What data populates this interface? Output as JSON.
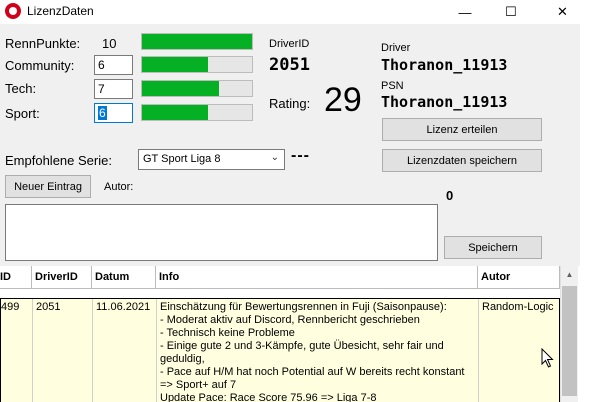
{
  "window": {
    "title": "LizenzDaten",
    "minimize": "—",
    "maximize": "☐",
    "close": "✕"
  },
  "points": {
    "rennpunkte_label": "RennPunkte:",
    "rennpunkte_value": "10",
    "rennpunkte_fraction": 1.0,
    "community_label": "Community:",
    "community_value": "6",
    "community_fraction": 0.6,
    "tech_label": "Tech:",
    "tech_value": "7",
    "tech_fraction": 0.7,
    "sport_label": "Sport:",
    "sport_value": "6",
    "sport_fraction": 0.6
  },
  "driver": {
    "driverid_caption": "DriverID",
    "driverid": "2051",
    "rating_caption": "Rating:",
    "rating": "29",
    "driver_caption": "Driver",
    "driver_name": "Thoranon_11913",
    "psn_caption": "PSN",
    "psn_name": "Thoranon_11913"
  },
  "buttons": {
    "lizenz_erteilen": "Lizenz erteilen",
    "lizenzdaten_speichern": "Lizenzdaten speichern",
    "neuer_eintrag": "Neuer Eintrag",
    "speichern": "Speichern"
  },
  "serie": {
    "label": "Empfohlene Serie:",
    "selected": "GT Sport Liga 8",
    "suffix": "---"
  },
  "entry": {
    "autor_label": "Autor:",
    "count": "0"
  },
  "table": {
    "headers": [
      "ID",
      "DriverID",
      "Datum",
      "Info",
      "Autor"
    ],
    "row": {
      "id": "499",
      "driverid": "2051",
      "datum": "11.06.2021",
      "info": [
        "Einschätzung für Bewertungsrennen in Fuji (Saisonpause):",
        "- Moderat aktiv auf Discord, Rennbericht geschrieben",
        "- Technisch keine Probleme",
        "- Einige gute 2 und 3-Kämpfe, gute Übesicht, sehr fair und",
        "geduldig,",
        "- Pace auf H/M hat noch Potential auf W bereits recht konstant",
        "=> Sport+ auf 7",
        "Update Pace: Race Score 75.96 => Liga 7-8"
      ],
      "autor": "Random-Logic"
    }
  },
  "colors": {
    "progress_fill": "#06b025",
    "row_highlight": "#ffffe0",
    "focus": "#0078d7"
  }
}
